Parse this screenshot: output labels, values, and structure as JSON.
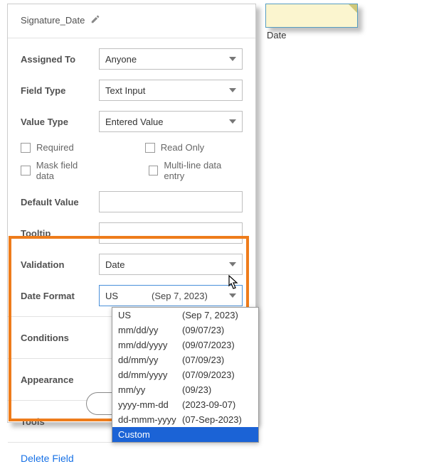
{
  "field_name": "Signature_Date",
  "field_box_label": "Date",
  "labels": {
    "assigned_to": "Assigned To",
    "field_type": "Field Type",
    "value_type": "Value Type",
    "default_value": "Default Value",
    "tooltip": "Tooltip",
    "validation": "Validation",
    "date_format": "Date Format",
    "conditions": "Conditions",
    "appearance": "Appearance",
    "tools": "Tools"
  },
  "values": {
    "assigned_to": "Anyone",
    "field_type": "Text Input",
    "value_type": "Entered Value",
    "validation": "Date"
  },
  "checkboxes": {
    "required": "Required",
    "read_only": "Read Only",
    "mask": "Mask field data",
    "multiline": "Multi-line data entry"
  },
  "date_format_selected": {
    "format": "US",
    "example": "(Sep 7, 2023)"
  },
  "date_format_options": [
    {
      "format": "US",
      "example": "(Sep 7, 2023)"
    },
    {
      "format": "mm/dd/yy",
      "example": "(09/07/23)"
    },
    {
      "format": "mm/dd/yyyy",
      "example": "(09/07/2023)"
    },
    {
      "format": "dd/mm/yy",
      "example": "(07/09/23)"
    },
    {
      "format": "dd/mm/yyyy",
      "example": "(07/09/2023)"
    },
    {
      "format": "mm/yy",
      "example": "(09/23)"
    },
    {
      "format": "yyyy-mm-dd",
      "example": "(2023-09-07)"
    },
    {
      "format": "dd-mmm-yyyy",
      "example": "(07-Sep-2023)"
    },
    {
      "format": "Custom",
      "example": ""
    }
  ],
  "delete_label": "Delete Field"
}
